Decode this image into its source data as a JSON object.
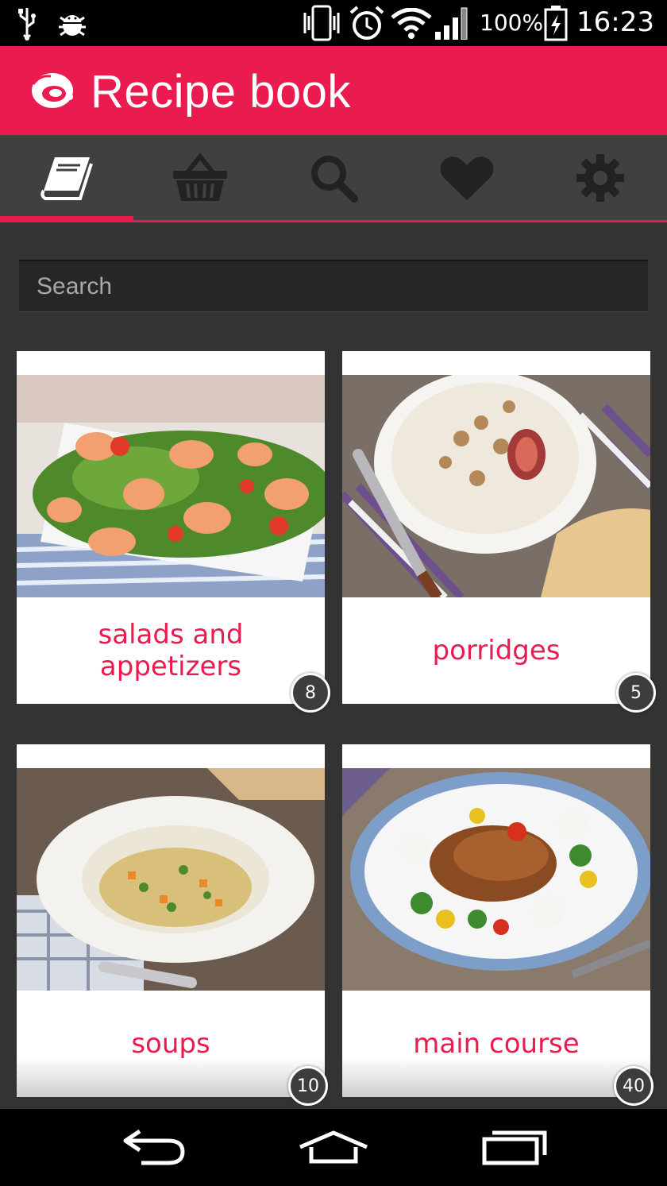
{
  "status_bar": {
    "battery": "100%",
    "time": "16:23"
  },
  "app_bar": {
    "title": "Recipe book",
    "brand_color": "#e91b4f"
  },
  "tabs": [
    {
      "icon": "book-icon",
      "active": true
    },
    {
      "icon": "basket-icon",
      "active": false
    },
    {
      "icon": "search-icon",
      "active": false
    },
    {
      "icon": "heart-icon",
      "active": false
    },
    {
      "icon": "gear-icon",
      "active": false
    }
  ],
  "search": {
    "placeholder": "Search",
    "value": ""
  },
  "categories": [
    {
      "label": "salads and appetizers",
      "count": "8",
      "image": "shrimp-salad"
    },
    {
      "label": "porridges",
      "count": "5",
      "image": "oatmeal-bowl"
    },
    {
      "label": "soups",
      "count": "10",
      "image": "vegetable-soup"
    },
    {
      "label": "main course",
      "count": "40",
      "image": "roast-chicken-plate"
    }
  ],
  "nav_bar": [
    "back-icon",
    "home-icon",
    "recents-icon"
  ]
}
